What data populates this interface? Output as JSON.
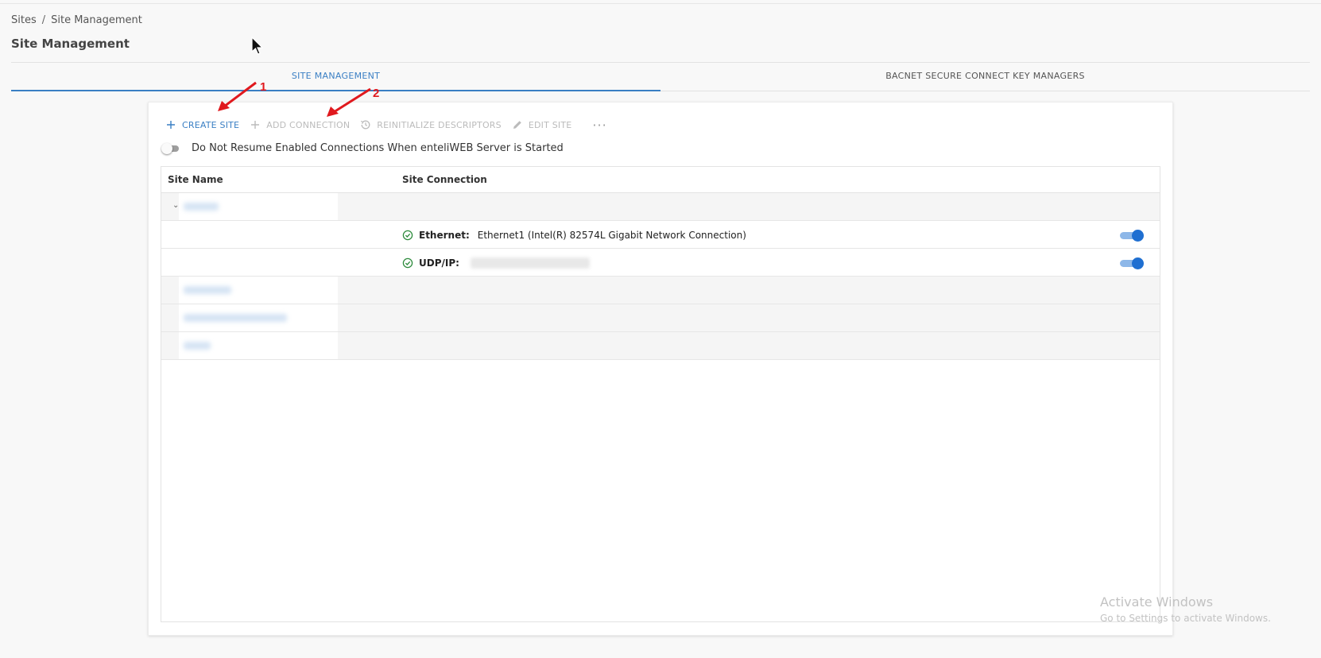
{
  "breadcrumb": {
    "root": "Sites",
    "separator": "/",
    "current": "Site Management"
  },
  "page_title": "Site Management",
  "tabs": [
    {
      "label": "SITE MANAGEMENT",
      "active": true
    },
    {
      "label": "BACNET SECURE CONNECT KEY MANAGERS",
      "active": false
    }
  ],
  "toolbar": {
    "create_site": "CREATE SITE",
    "add_connection": "ADD CONNECTION",
    "reinitialize": "REINITIALIZE DESCRIPTORS",
    "edit_site": "EDIT SITE",
    "more": "···"
  },
  "resume_toggle": {
    "label": "Do Not Resume Enabled Connections When enteliWEB Server is Started",
    "on": false
  },
  "table": {
    "headers": {
      "site_name": "Site Name",
      "site_connection": "Site Connection"
    },
    "connections": [
      {
        "type": "Ethernet:",
        "value": "Ethernet1 (Intel(R) 82574L Gigabit Network Connection)",
        "enabled": true
      },
      {
        "type": "UDP/IP:",
        "value": "",
        "enabled": true
      }
    ]
  },
  "annotations": {
    "marker1": "1",
    "marker2": "2"
  },
  "watermark": {
    "line1": "Activate Windows",
    "line2": "Go to Settings to activate Windows."
  },
  "colors": {
    "accent": "#3a7fc4",
    "switch_on": "#1f6fd1",
    "annotation": "#e0191e",
    "success": "#2e8b3d"
  }
}
